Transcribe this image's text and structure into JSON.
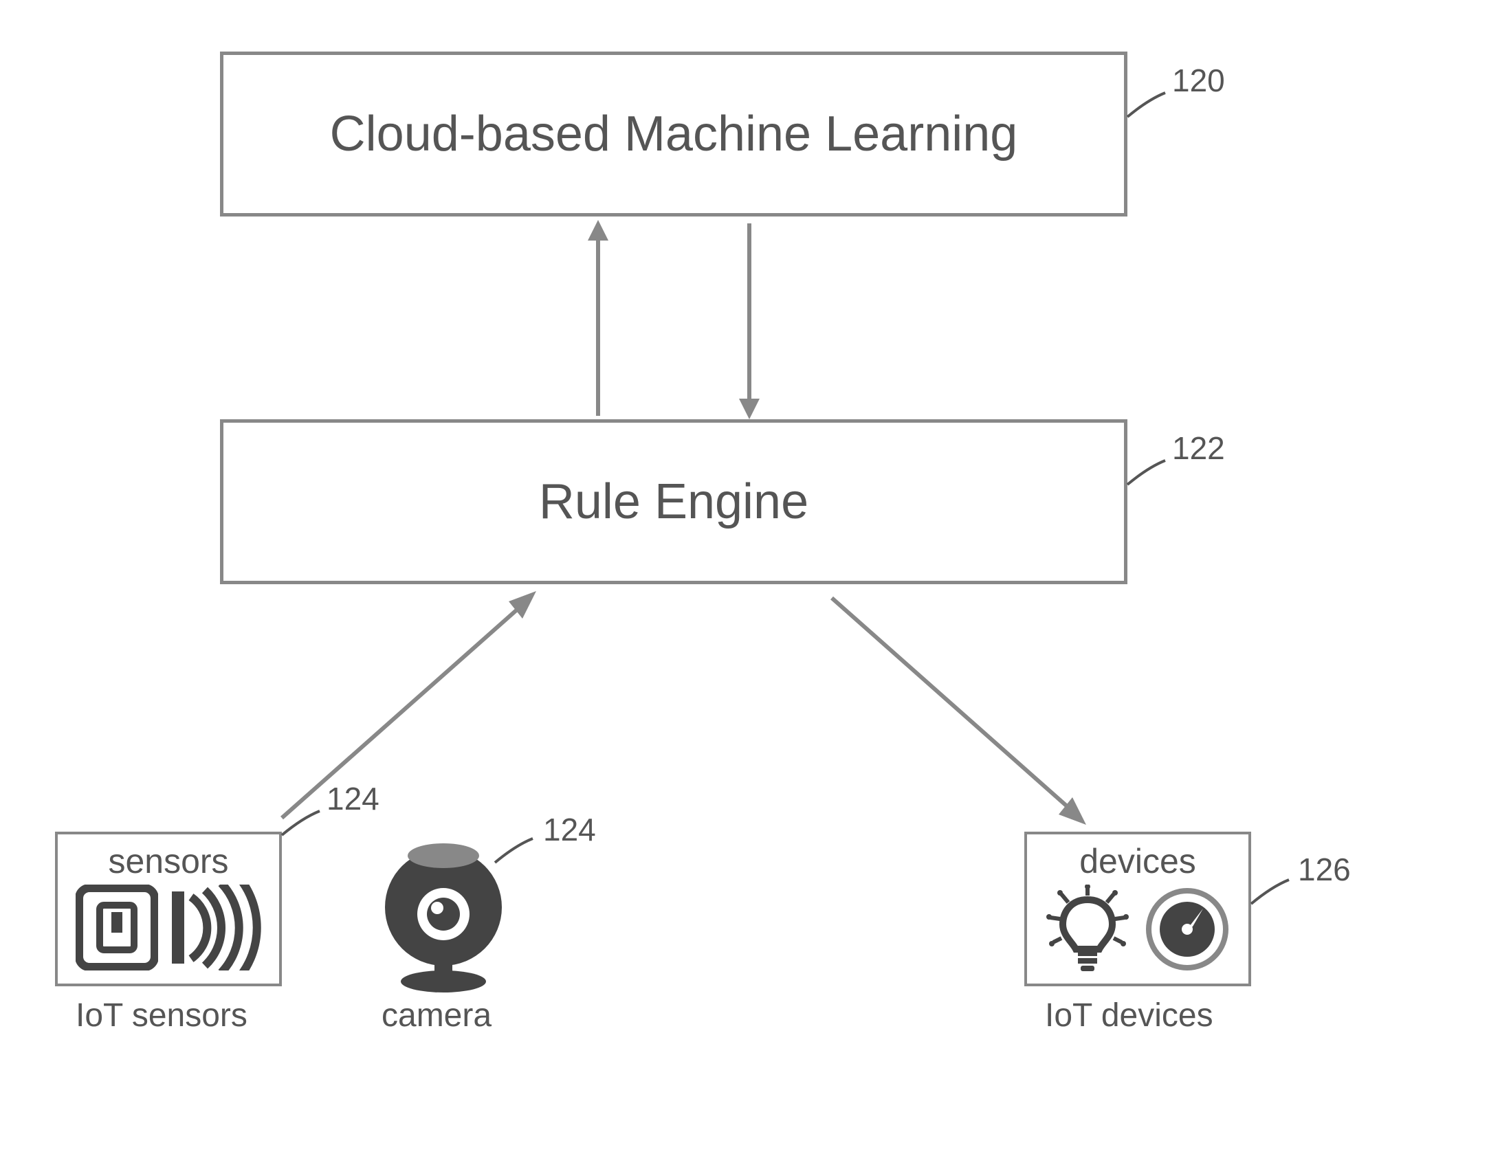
{
  "boxes": {
    "cloud": {
      "label": "Cloud-based Machine Learning",
      "ref": "120"
    },
    "rule": {
      "label": "Rule Engine",
      "ref": "122"
    }
  },
  "sensors": {
    "box_label": "sensors",
    "below_label": "IoT sensors",
    "ref": "124"
  },
  "camera": {
    "below_label": "camera",
    "ref": "124"
  },
  "devices": {
    "box_label": "devices",
    "below_label": "IoT devices",
    "ref": "126"
  }
}
